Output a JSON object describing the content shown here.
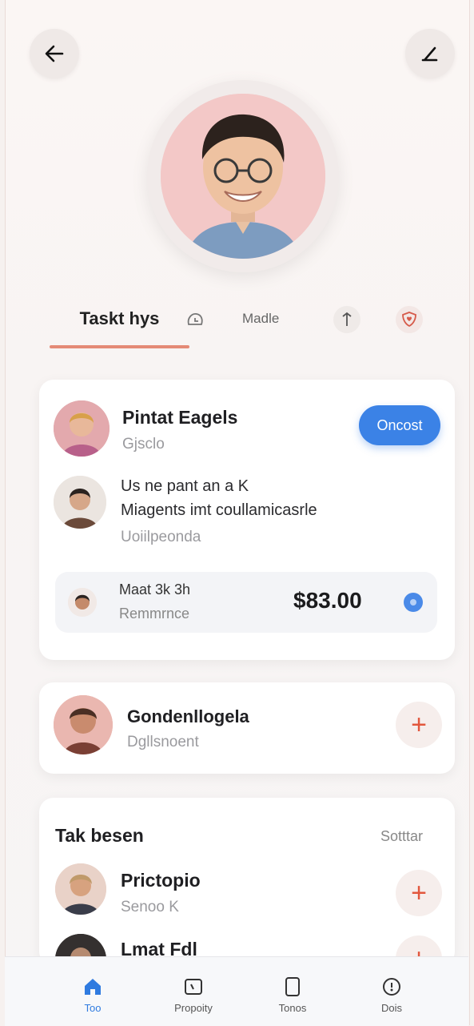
{
  "header": {
    "back_icon": "arrow-left-icon",
    "edit_icon": "pencil-icon"
  },
  "tabs": {
    "active_label": "Taskt hys",
    "second_label": "Madle",
    "icons": [
      "clock-icon",
      "pin-icon",
      "heart-shield-icon"
    ]
  },
  "card1": {
    "name": "Pintat Eagels",
    "subtitle": "Gjsclo",
    "action_label": "Oncost",
    "message_line1": "Us ne pant an a K",
    "message_line2": "Miagents imt coullamicasrle",
    "message_subtitle": "Uoiilpeonda",
    "payment_title": "Maat 3k 3h",
    "payment_subtitle": "Remmrnce",
    "payment_amount": "$83.00"
  },
  "card2": {
    "name": "Gondenllogela",
    "subtitle": "Dgllsnoent"
  },
  "card3": {
    "section_title": "Tak besen",
    "section_action": "Sotttar",
    "item1_name": "Prictopio",
    "item1_subtitle": "Senoo K",
    "item2_name": "Lmat Fdl"
  },
  "bottom_nav": {
    "items": [
      {
        "label": "Too",
        "icon": "home-icon"
      },
      {
        "label": "Propoity",
        "icon": "tablet-icon"
      },
      {
        "label": "Tonos",
        "icon": "phone-icon"
      },
      {
        "label": "Dois",
        "icon": "compass-icon"
      }
    ]
  },
  "colors": {
    "accent": "#e48a76",
    "primary": "#3b82e6",
    "plus": "#e2573d"
  }
}
